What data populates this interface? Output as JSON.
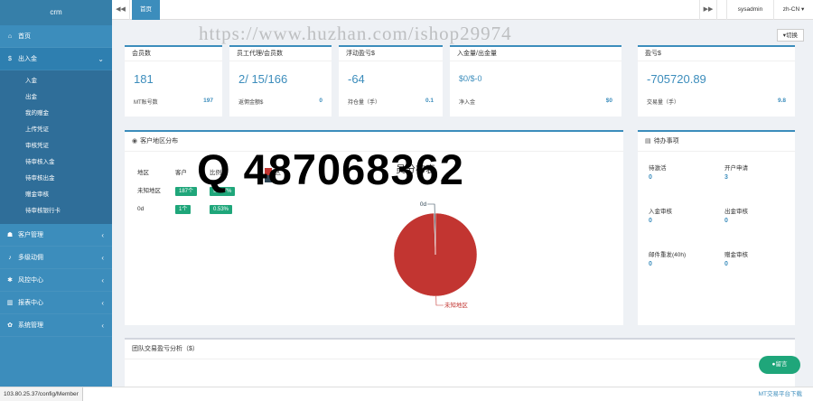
{
  "app": {
    "logo": "crm"
  },
  "sidebar": {
    "items": [
      {
        "icon": "home-icon",
        "glyph": "⌂",
        "label": "首页",
        "chevron": ""
      },
      {
        "icon": "dollar-icon",
        "glyph": "$",
        "label": "出入金",
        "chevron": "⌄"
      },
      {
        "icon": "user-icon",
        "glyph": "☗",
        "label": "客户管理",
        "chevron": "‹"
      },
      {
        "icon": "bell-icon",
        "glyph": "♪",
        "label": "多级动佣",
        "chevron": "‹"
      },
      {
        "icon": "gear-icon",
        "glyph": "✱",
        "label": "风控中心",
        "chevron": "‹"
      },
      {
        "icon": "bar-chart-icon",
        "glyph": "▥",
        "label": "报表中心",
        "chevron": "‹"
      },
      {
        "icon": "cog-icon",
        "glyph": "✿",
        "label": "系统管理",
        "chevron": "‹"
      }
    ],
    "submenu": [
      "入金",
      "出金",
      "我的赠金",
      "上传凭证",
      "审核凭证",
      "待审核入金",
      "待审核出金",
      "赠金审核",
      "待审核银行卡"
    ]
  },
  "topnav": {
    "prev_icon": "double-left-icon",
    "prev_glyph": "◀◀",
    "tab_label": "首页",
    "next_glyph": "▶▶",
    "user": "sysadmin",
    "lang": "zh-CN ▾"
  },
  "main": {
    "switch_label": "▾切换",
    "stats": [
      {
        "title": "会员数",
        "value": "181",
        "sub_label": "MT账号数",
        "sub_value": "197"
      },
      {
        "title": "员工代理/会员数",
        "value": "2/ 15/166",
        "sub_label": "返佣金额$",
        "sub_value": "0"
      },
      {
        "title": "浮动盈亏$",
        "value": "-64",
        "sub_label": "持仓量（手）",
        "sub_value": "0.1"
      },
      {
        "title": "入金量/出金量",
        "value": "$0/$-0",
        "sub_label": "净入金",
        "sub_value": "$0"
      },
      {
        "title": "盈亏$",
        "value": "-705720.89",
        "sub_label": "交易量（手）",
        "sub_value": "9.8"
      }
    ],
    "region_panel": {
      "title": "客户地区分布",
      "headers": [
        "地区",
        "客户",
        "比例"
      ],
      "rows": [
        {
          "region": "未知地区",
          "count": "187个",
          "pct": "99.47%"
        },
        {
          "region": "0d",
          "count": "1个",
          "pct": "0.53%"
        }
      ],
      "legend_text": "区",
      "chart_title_suffix": "员分布表"
    },
    "todo_panel": {
      "title": "待办事项",
      "items": [
        {
          "label": "待激活",
          "value": "0"
        },
        {
          "label": "开户申请",
          "value": "3"
        },
        {
          "label": "入金审核",
          "value": "0"
        },
        {
          "label": "出金审核",
          "value": "0"
        },
        {
          "label": "邮件重发(40h)",
          "value": "0"
        },
        {
          "label": "赠金审核",
          "value": "0"
        }
      ]
    },
    "team_panel": {
      "title": "团队交易盈亏分析（$）"
    },
    "fab_label": "●留言"
  },
  "watermarks": {
    "url_text": "https://www.huzhan.com/ishop29974",
    "qq_text": "Q 487068362"
  },
  "statusbar": {
    "url": "103.80.25.37/config/Member",
    "download": "MT交易平台下载"
  },
  "chart_data": {
    "type": "pie",
    "title": "",
    "categories": [
      "未知地区",
      "0d"
    ],
    "values": [
      187,
      1
    ],
    "percentages": [
      99.47,
      0.53
    ],
    "colors": [
      "#c23531",
      "#2f4554"
    ],
    "labels": [
      "未知地区",
      "0d"
    ]
  }
}
